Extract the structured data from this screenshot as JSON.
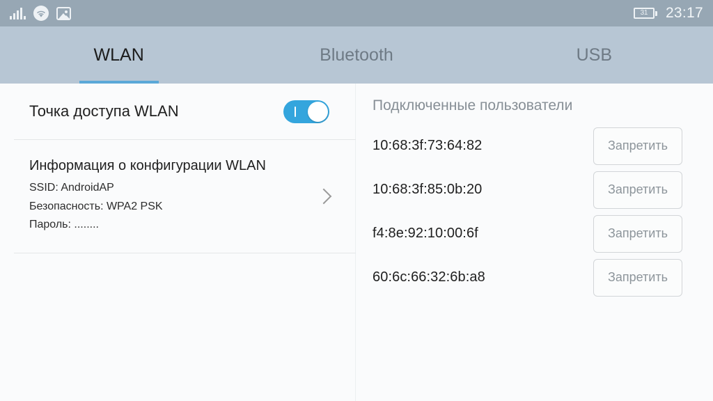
{
  "statusbar": {
    "icons": [
      "signal-bars-icon",
      "wifi-icon",
      "photo-icon"
    ],
    "battery_level": "31",
    "time": "23:17"
  },
  "tabs": [
    {
      "label": "WLAN",
      "active": true
    },
    {
      "label": "Bluetooth",
      "active": false
    },
    {
      "label": "USB",
      "active": false
    }
  ],
  "left_panel": {
    "hotspot": {
      "label": "Точка доступа WLAN",
      "toggle_state": "on"
    },
    "config": {
      "title": "Информация о конфигурации WLAN",
      "ssid_line": "SSID: AndroidAP",
      "security_line": "Безопасность: WPA2 PSK",
      "password_line": "Пароль: ........"
    }
  },
  "right_panel": {
    "title": "Подключенные пользователи",
    "deny_label": "Запретить",
    "users": [
      {
        "mac": "10:68:3f:73:64:82"
      },
      {
        "mac": "10:68:3f:85:0b:20"
      },
      {
        "mac": "f4:8e:92:10:00:6f"
      },
      {
        "mac": "60:6c:66:32:6b:a8"
      }
    ]
  },
  "colors": {
    "statusbar_bg": "#97a7b4",
    "tabbar_bg": "#b7c6d4",
    "accent": "#5ba8d8",
    "toggle_on": "#34a5dd",
    "content_bg": "#fafbfc"
  }
}
